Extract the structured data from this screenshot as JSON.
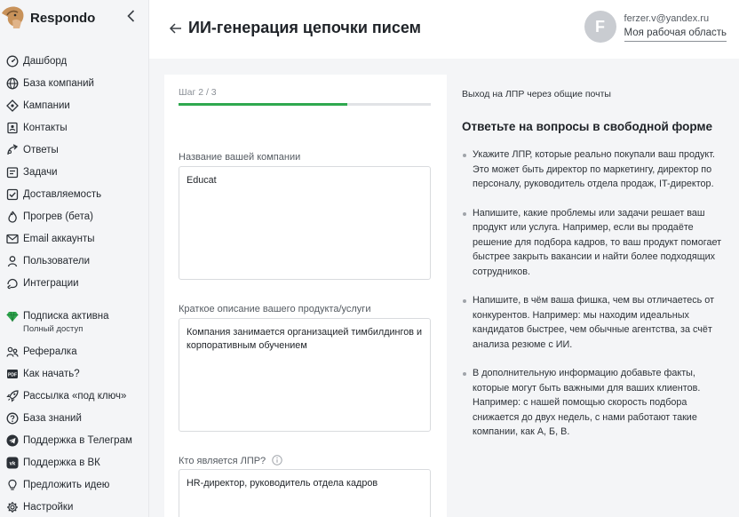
{
  "brand": {
    "name": "Respondo"
  },
  "sidebar": {
    "items": [
      {
        "label": "Дашборд",
        "icon": "dashboard-icon"
      },
      {
        "label": "База компаний",
        "icon": "companies-icon"
      },
      {
        "label": "Кампании",
        "icon": "campaigns-icon"
      },
      {
        "label": "Контакты",
        "icon": "contacts-icon"
      },
      {
        "label": "Ответы",
        "icon": "replies-icon"
      },
      {
        "label": "Задачи",
        "icon": "tasks-icon"
      },
      {
        "label": "Доставляемость",
        "icon": "deliverability-icon"
      },
      {
        "label": "Прогрев (бета)",
        "icon": "warmup-icon"
      },
      {
        "label": "Email аккаунты",
        "icon": "email-icon"
      },
      {
        "label": "Пользователи",
        "icon": "users-icon"
      },
      {
        "label": "Интеграции",
        "icon": "integrations-icon"
      }
    ],
    "subscription": {
      "label": "Подписка активна",
      "note": "Полный доступ",
      "color": "#2fa84f"
    },
    "items2": [
      {
        "label": "Рефералка",
        "icon": "referral-icon"
      },
      {
        "label": "Как начать?",
        "icon": "pdf-icon"
      },
      {
        "label": "Рассылка «под ключ»",
        "icon": "rocket-icon"
      },
      {
        "label": "База знаний",
        "icon": "question-icon"
      },
      {
        "label": "Поддержка в Телеграм",
        "icon": "telegram-icon"
      },
      {
        "label": "Поддержка в ВК",
        "icon": "vk-icon"
      },
      {
        "label": "Предложить идею",
        "icon": "lightbulb-icon"
      },
      {
        "label": "Настройки",
        "icon": "settings-icon"
      }
    ]
  },
  "header": {
    "title": "ИИ-генерация цепочки писем",
    "user_email": "ferzer.v@yandex.ru",
    "workspace": "Моя рабочая область",
    "avatar_letter": "F"
  },
  "form": {
    "step": "Шаг 2 / 3",
    "progress": 0.67,
    "company_label": "Название вашей компании",
    "company_value": "Educat",
    "product_label": "Краткое описание вашего продукта/услуги",
    "product_value": "Компания занимается организацией тимбилдингов и корпоративным обучением",
    "lpr_label": "Кто является ЛПР?",
    "lpr_value": "HR-директор, руководитель отдела кадров"
  },
  "help": {
    "top": "Выход на ЛПР через общие почты",
    "title": "Ответьте на вопросы в свободной форме",
    "items": [
      "Укажите ЛПР, которые реально покупали ваш продукт. Это может быть директор по маркетингу, директор по персоналу, руководитель отдела продаж, IT-директор.",
      "Напишите, какие проблемы или задачи решает ваш продукт или услуга. Например, если вы продаёте решение для подбора кадров, то ваш продукт помогает быстрее закрыть вакансии и найти более подходящих сотрудников.",
      "Напишите, в чём ваша фишка, чем вы отличаетесь от конкурентов. Например: мы находим идеальных кандидатов быстрее, чем обычные агентства, за счёт анализа резюме с ИИ.",
      "В дополнительную информацию добавьте факты, которые могут быть важными для ваших клиентов. Например: с нашей помощью скорость подбора снижается до двух недель, с нами работают такие компании, как А, Б, В."
    ]
  }
}
